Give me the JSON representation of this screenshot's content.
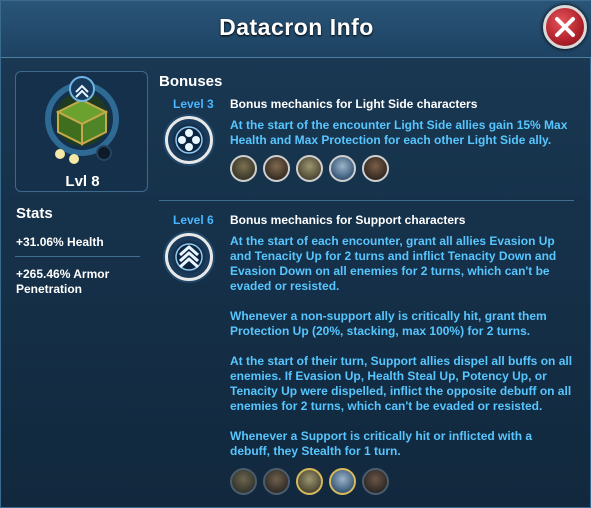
{
  "window": {
    "title": "Datacron Info"
  },
  "datacron": {
    "level_label": "Lvl 8"
  },
  "stats": {
    "heading": "Stats",
    "items": [
      "+31.06% Health",
      "+265.46% Armor Penetration"
    ]
  },
  "bonuses": {
    "heading": "Bonuses",
    "entries": [
      {
        "level": "Level 3",
        "title": "Bonus mechanics for Light Side characters",
        "paragraphs": [
          "At the start of the encounter Light Side allies gain 15% Max Health and Max Protection for each other Light Side ally."
        ],
        "icon": "light-side-emblem-icon"
      },
      {
        "level": "Level 6",
        "title": "Bonus mechanics for Support characters",
        "paragraphs": [
          "At the start of each encounter, grant all allies Evasion Up and Tenacity Up for 2 turns and inflict Tenacity Down and Evasion Down on all enemies for 2 turns, which can't be evaded or resisted.",
          "Whenever a non-support ally is critically hit, grant them Protection Up (20%, stacking, max 100%) for 2 turns.",
          "At the start of their turn, Support allies dispel all buffs on all enemies. If Evasion Up, Health Steal Up, Potency Up, or Tenacity Up were dispelled, inflict the opposite debuff on all enemies for 2 turns, which can't be evaded or resisted.",
          "Whenever a Support is critically hit or inflicted with a debuff, they Stealth for 1 turn."
        ],
        "icon": "support-chevrons-icon"
      }
    ]
  },
  "colors": {
    "accent": "#49b6ff",
    "description": "#57c6ff",
    "close": "#c0282f"
  }
}
